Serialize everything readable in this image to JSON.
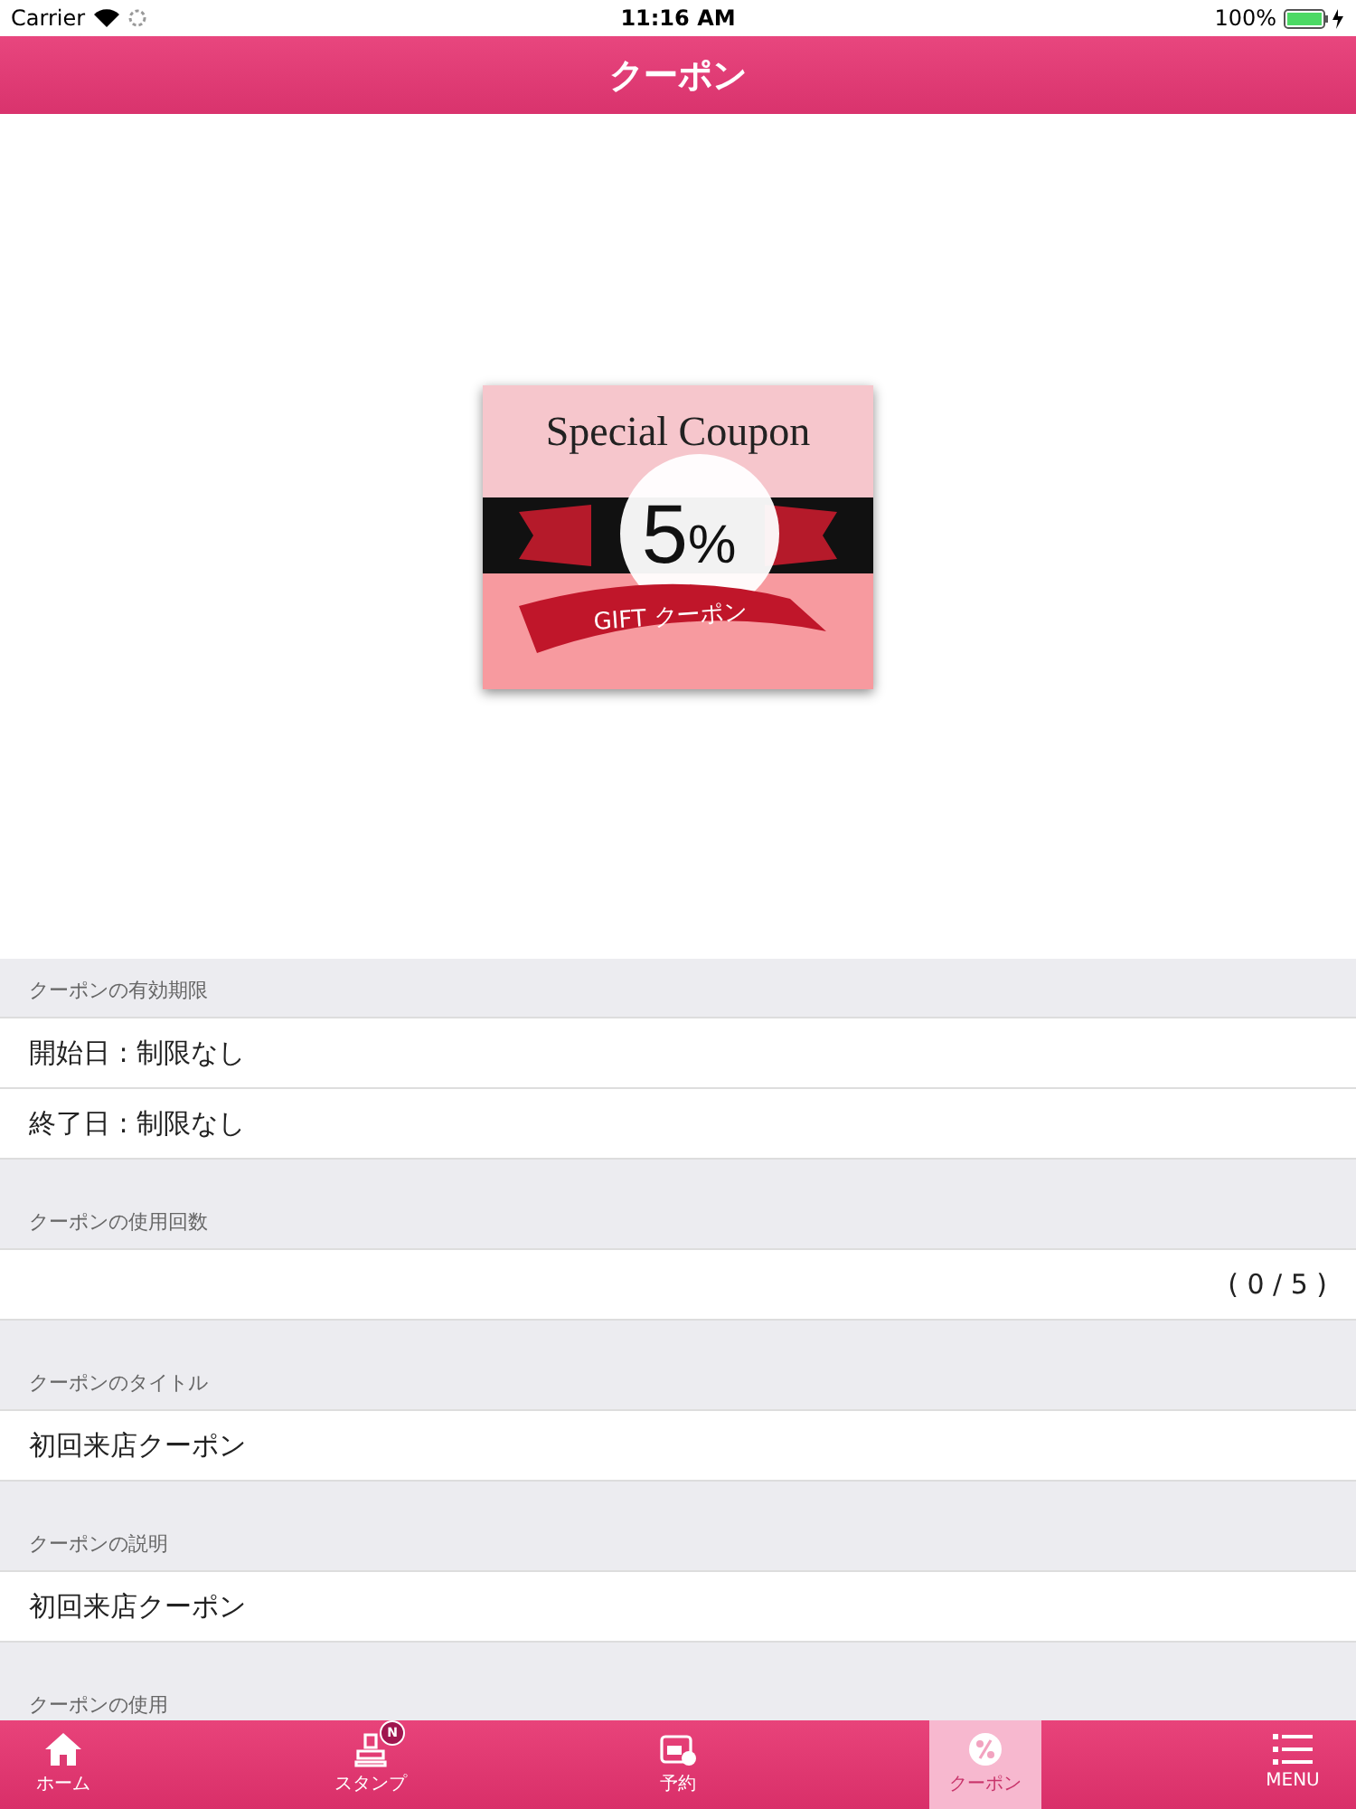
{
  "status_bar": {
    "carrier": "Carrier",
    "time": "11:16 AM",
    "battery": "100%"
  },
  "nav_bar": {
    "title": "クーポン"
  },
  "coupon_image": {
    "heading": "Special Coupon",
    "discount": "5",
    "percent": "%",
    "ribbon": "GIFT クーポン"
  },
  "sections": [
    {
      "header": "クーポンの有効期限",
      "rows": [
        {
          "kind": "text",
          "text": "開始日 : 制限なし"
        },
        {
          "kind": "text",
          "text": "終了日 : 制限なし"
        }
      ]
    },
    {
      "header": "クーポンの使用回数",
      "rows": [
        {
          "kind": "count",
          "text": "( 0 / 5 )"
        }
      ]
    },
    {
      "header": "クーポンのタイトル",
      "rows": [
        {
          "kind": "text",
          "text": "初回来店クーポン"
        }
      ]
    },
    {
      "header": "クーポンの説明",
      "rows": [
        {
          "kind": "text",
          "text": "初回来店クーポン"
        }
      ]
    },
    {
      "header": "クーポンの使用"
    }
  ],
  "tab_bar": [
    {
      "kind": "home",
      "label": "ホーム",
      "selected": false
    },
    {
      "kind": "stamp",
      "label": "スタンプ",
      "selected": false,
      "badge": "N"
    },
    {
      "kind": "calendar",
      "label": "予約",
      "selected": false
    },
    {
      "kind": "coupon",
      "label": "クーポン",
      "selected": true
    },
    {
      "kind": "menu",
      "label": "MENU",
      "selected": false
    }
  ]
}
